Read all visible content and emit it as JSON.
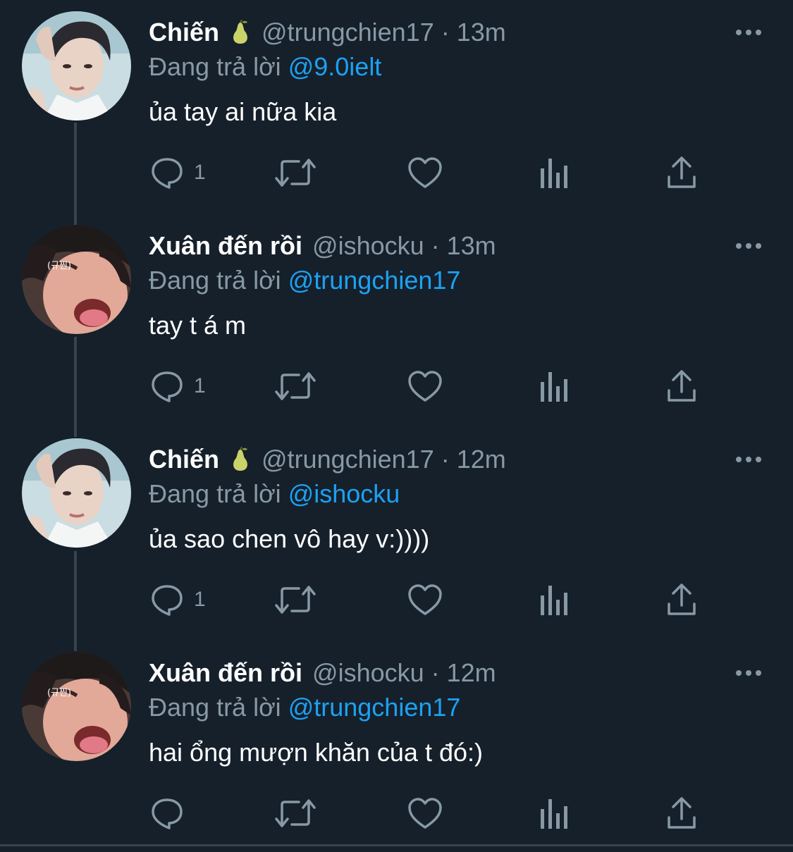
{
  "tweets": [
    {
      "name": "Chiến",
      "has_emoji": true,
      "emoji_icon": "pear-icon",
      "handle": "@trungchien17",
      "separator": "·",
      "time": "13m",
      "reply_prefix": "Đang trả lời",
      "reply_to": "@9.0ielt",
      "text": "ủa tay ai nữa kia",
      "reply_count": "1"
    },
    {
      "name": "Xuân đến rồi",
      "has_emoji": false,
      "handle": "@ishocku",
      "separator": "·",
      "time": "13m",
      "reply_prefix": "Đang trả lời",
      "reply_to": "@trungchien17",
      "text": "tay t á m",
      "reply_count": "1"
    },
    {
      "name": "Chiến",
      "has_emoji": true,
      "emoji_icon": "pear-icon",
      "handle": "@trungchien17",
      "separator": "·",
      "time": "12m",
      "reply_prefix": "Đang trả lời",
      "reply_to": "@ishocku",
      "text": "ủa sao chen vô hay v:))))",
      "reply_count": "1"
    },
    {
      "name": "Xuân đến rồi",
      "has_emoji": false,
      "handle": "@ishocku",
      "separator": "·",
      "time": "12m",
      "reply_prefix": "Đang trả lời",
      "reply_to": "@trungchien17",
      "text": "hai ổng mượn khăn của t đó:)",
      "reply_count": ""
    }
  ],
  "avatar_overlay_text": "(규찐)",
  "icons": {
    "reply": "reply-icon",
    "retweet": "retweet-icon",
    "like": "heart-icon",
    "analytics": "analytics-icon",
    "share": "share-icon",
    "more": "more-icon"
  },
  "colors": {
    "background": "#15202b",
    "text": "#ffffff",
    "secondary": "#8899a6",
    "accent": "#1da1f2",
    "line": "#38444d"
  }
}
